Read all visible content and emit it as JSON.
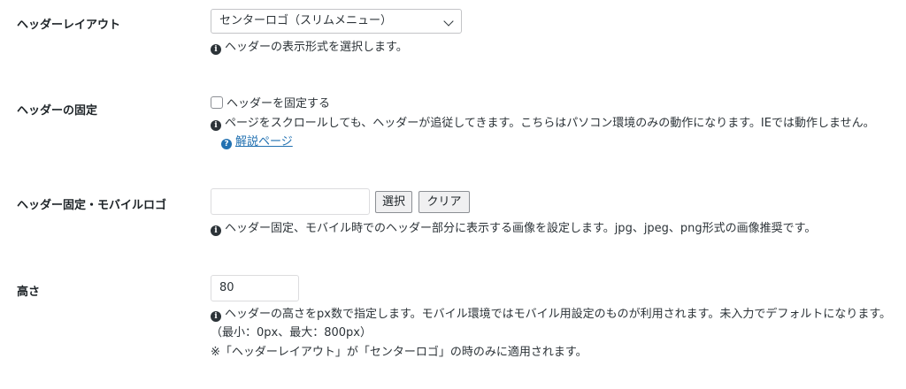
{
  "header_layout": {
    "label": "ヘッダーレイアウト",
    "select_value": "センターロゴ（スリムメニュー）",
    "description": "ヘッダーの表示形式を選択します。"
  },
  "header_fixed": {
    "label": "ヘッダーの固定",
    "checkbox_label": "ヘッダーを固定する",
    "checked": false,
    "description": "ページをスクロールしても、ヘッダーが追従してきます。こちらはパソコン環境のみの動作になります。IEでは動作しません。",
    "help_link": "解説ページ"
  },
  "fixed_mobile_logo": {
    "label": "ヘッダー固定・モバイルロゴ",
    "input_value": "",
    "select_button": "選択",
    "clear_button": "クリア",
    "description": "ヘッダー固定、モバイル時でのヘッダー部分に表示する画像を設定します。jpg、jpeg、png形式の画像推奨です。"
  },
  "height": {
    "label": "高さ",
    "input_value": "80",
    "description": "ヘッダーの高さをpx数で指定します。モバイル環境ではモバイル用設定のものが利用されます。未入力でデフォルトになります。（最小：0px、最大：800px）",
    "note": "※「ヘッダーレイアウト」が「センターロゴ」の時のみに適用されます。"
  },
  "icons": {
    "info": "info-icon",
    "help": "help-circle-icon",
    "chevron": "chevron-down-icon"
  },
  "colors": {
    "link": "#2271b1",
    "text": "#2c3338",
    "border": "#c3c4c7"
  }
}
